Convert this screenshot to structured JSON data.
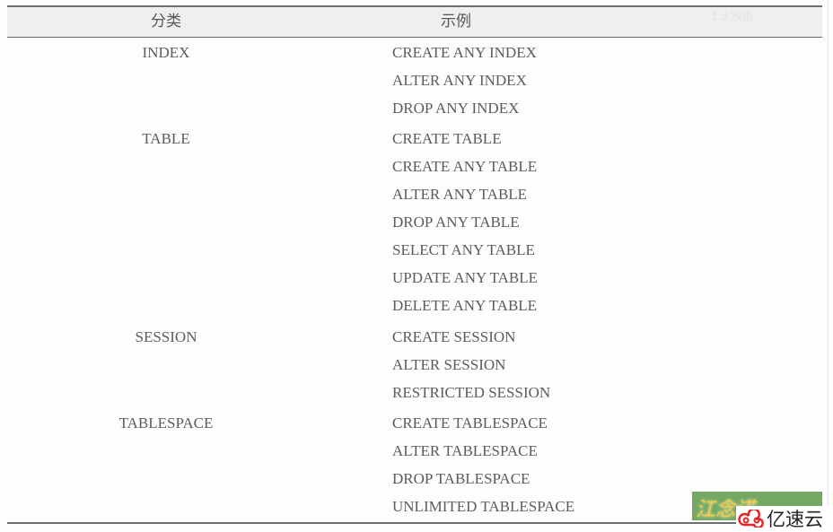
{
  "table": {
    "headers": {
      "category": "分类",
      "example": "示例"
    },
    "header_faint_text": "1.3 权限",
    "groups": [
      {
        "category": "INDEX",
        "examples": [
          "CREATE ANY INDEX",
          "ALTER ANY INDEX",
          "DROP ANY INDEX"
        ]
      },
      {
        "category": "TABLE",
        "examples": [
          "CREATE TABLE",
          "CREATE ANY TABLE",
          "ALTER ANY TABLE",
          "DROP ANY TABLE",
          "SELECT ANY TABLE",
          "UPDATE ANY TABLE",
          "DELETE ANY TABLE"
        ]
      },
      {
        "category": "SESSION",
        "examples": [
          "CREATE SESSION",
          "ALTER SESSION",
          "RESTRICTED SESSION"
        ]
      },
      {
        "category": "TABLESPACE",
        "examples": [
          "CREATE TABLESPACE",
          "ALTER TABLESPACE",
          "DROP TABLESPACE",
          "UNLIMITED TABLESPACE"
        ]
      }
    ]
  },
  "watermark": {
    "overlay_text": "江念诺",
    "brand_text": "亿速云",
    "brand_icon": "cloud-logo-icon",
    "colors": {
      "green": "#74a864",
      "yellow": "#f4c84a",
      "red": "#e0262a"
    }
  }
}
